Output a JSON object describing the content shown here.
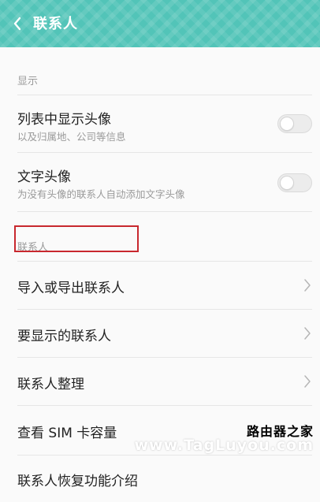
{
  "header": {
    "title": "联系人",
    "back_icon": "chevron-left-icon",
    "color": "#52c4b8"
  },
  "sections": {
    "display_label": "显示",
    "contacts_label": "联系人"
  },
  "settings": {
    "show_avatar": {
      "title": "列表中显示头像",
      "subtitle": "以及归属地、公司等信息",
      "enabled": false
    },
    "text_avatar": {
      "title": "文字头像",
      "subtitle": "为没有头像的联系人自动添加文字头像",
      "enabled": false
    }
  },
  "menu": {
    "import_export": "导入或导出联系人",
    "display_contacts": "要显示的联系人",
    "organize": "联系人整理",
    "sim_capacity": "查看 SIM 卡容量",
    "restore_intro": "联系人恢复功能介绍"
  },
  "highlight_color": "#c8282e",
  "watermark": {
    "cn": "路由器之家",
    "en": "www.TagLuyou.com"
  }
}
